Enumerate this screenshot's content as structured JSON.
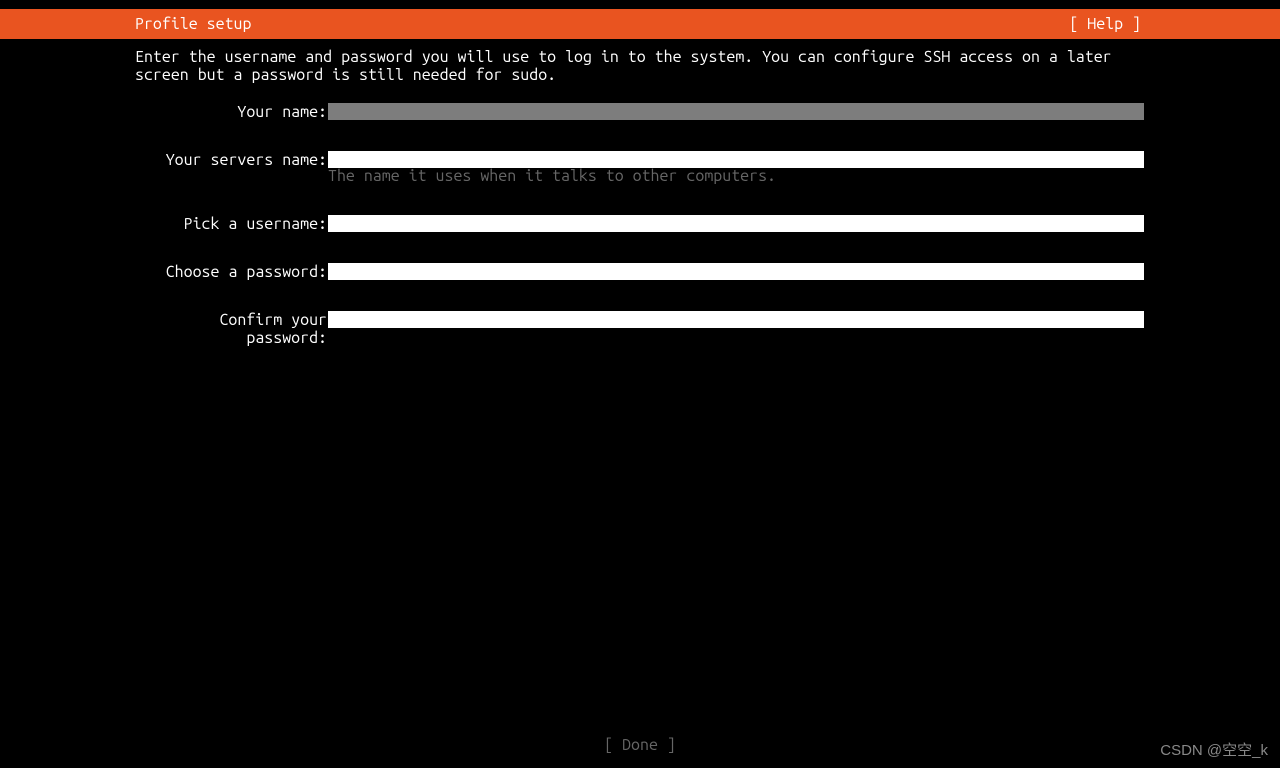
{
  "header": {
    "title": "Profile setup",
    "help": "[ Help ]"
  },
  "instructions": "Enter the username and password you will use to log in to the system. You can configure SSH access on a later screen but a password is still needed for sudo.",
  "form": {
    "name": {
      "label": "Your name:",
      "value": ""
    },
    "server_name": {
      "label": "Your servers name:",
      "value": "",
      "hint": "The name it uses when it talks to other computers."
    },
    "username": {
      "label": "Pick a username:",
      "value": ""
    },
    "password": {
      "label": "Choose a password:",
      "value": ""
    },
    "confirm_password": {
      "label": "Confirm your password:",
      "value": ""
    }
  },
  "footer": {
    "done": "[ Done       ]"
  },
  "watermark": "CSDN @空空_k"
}
